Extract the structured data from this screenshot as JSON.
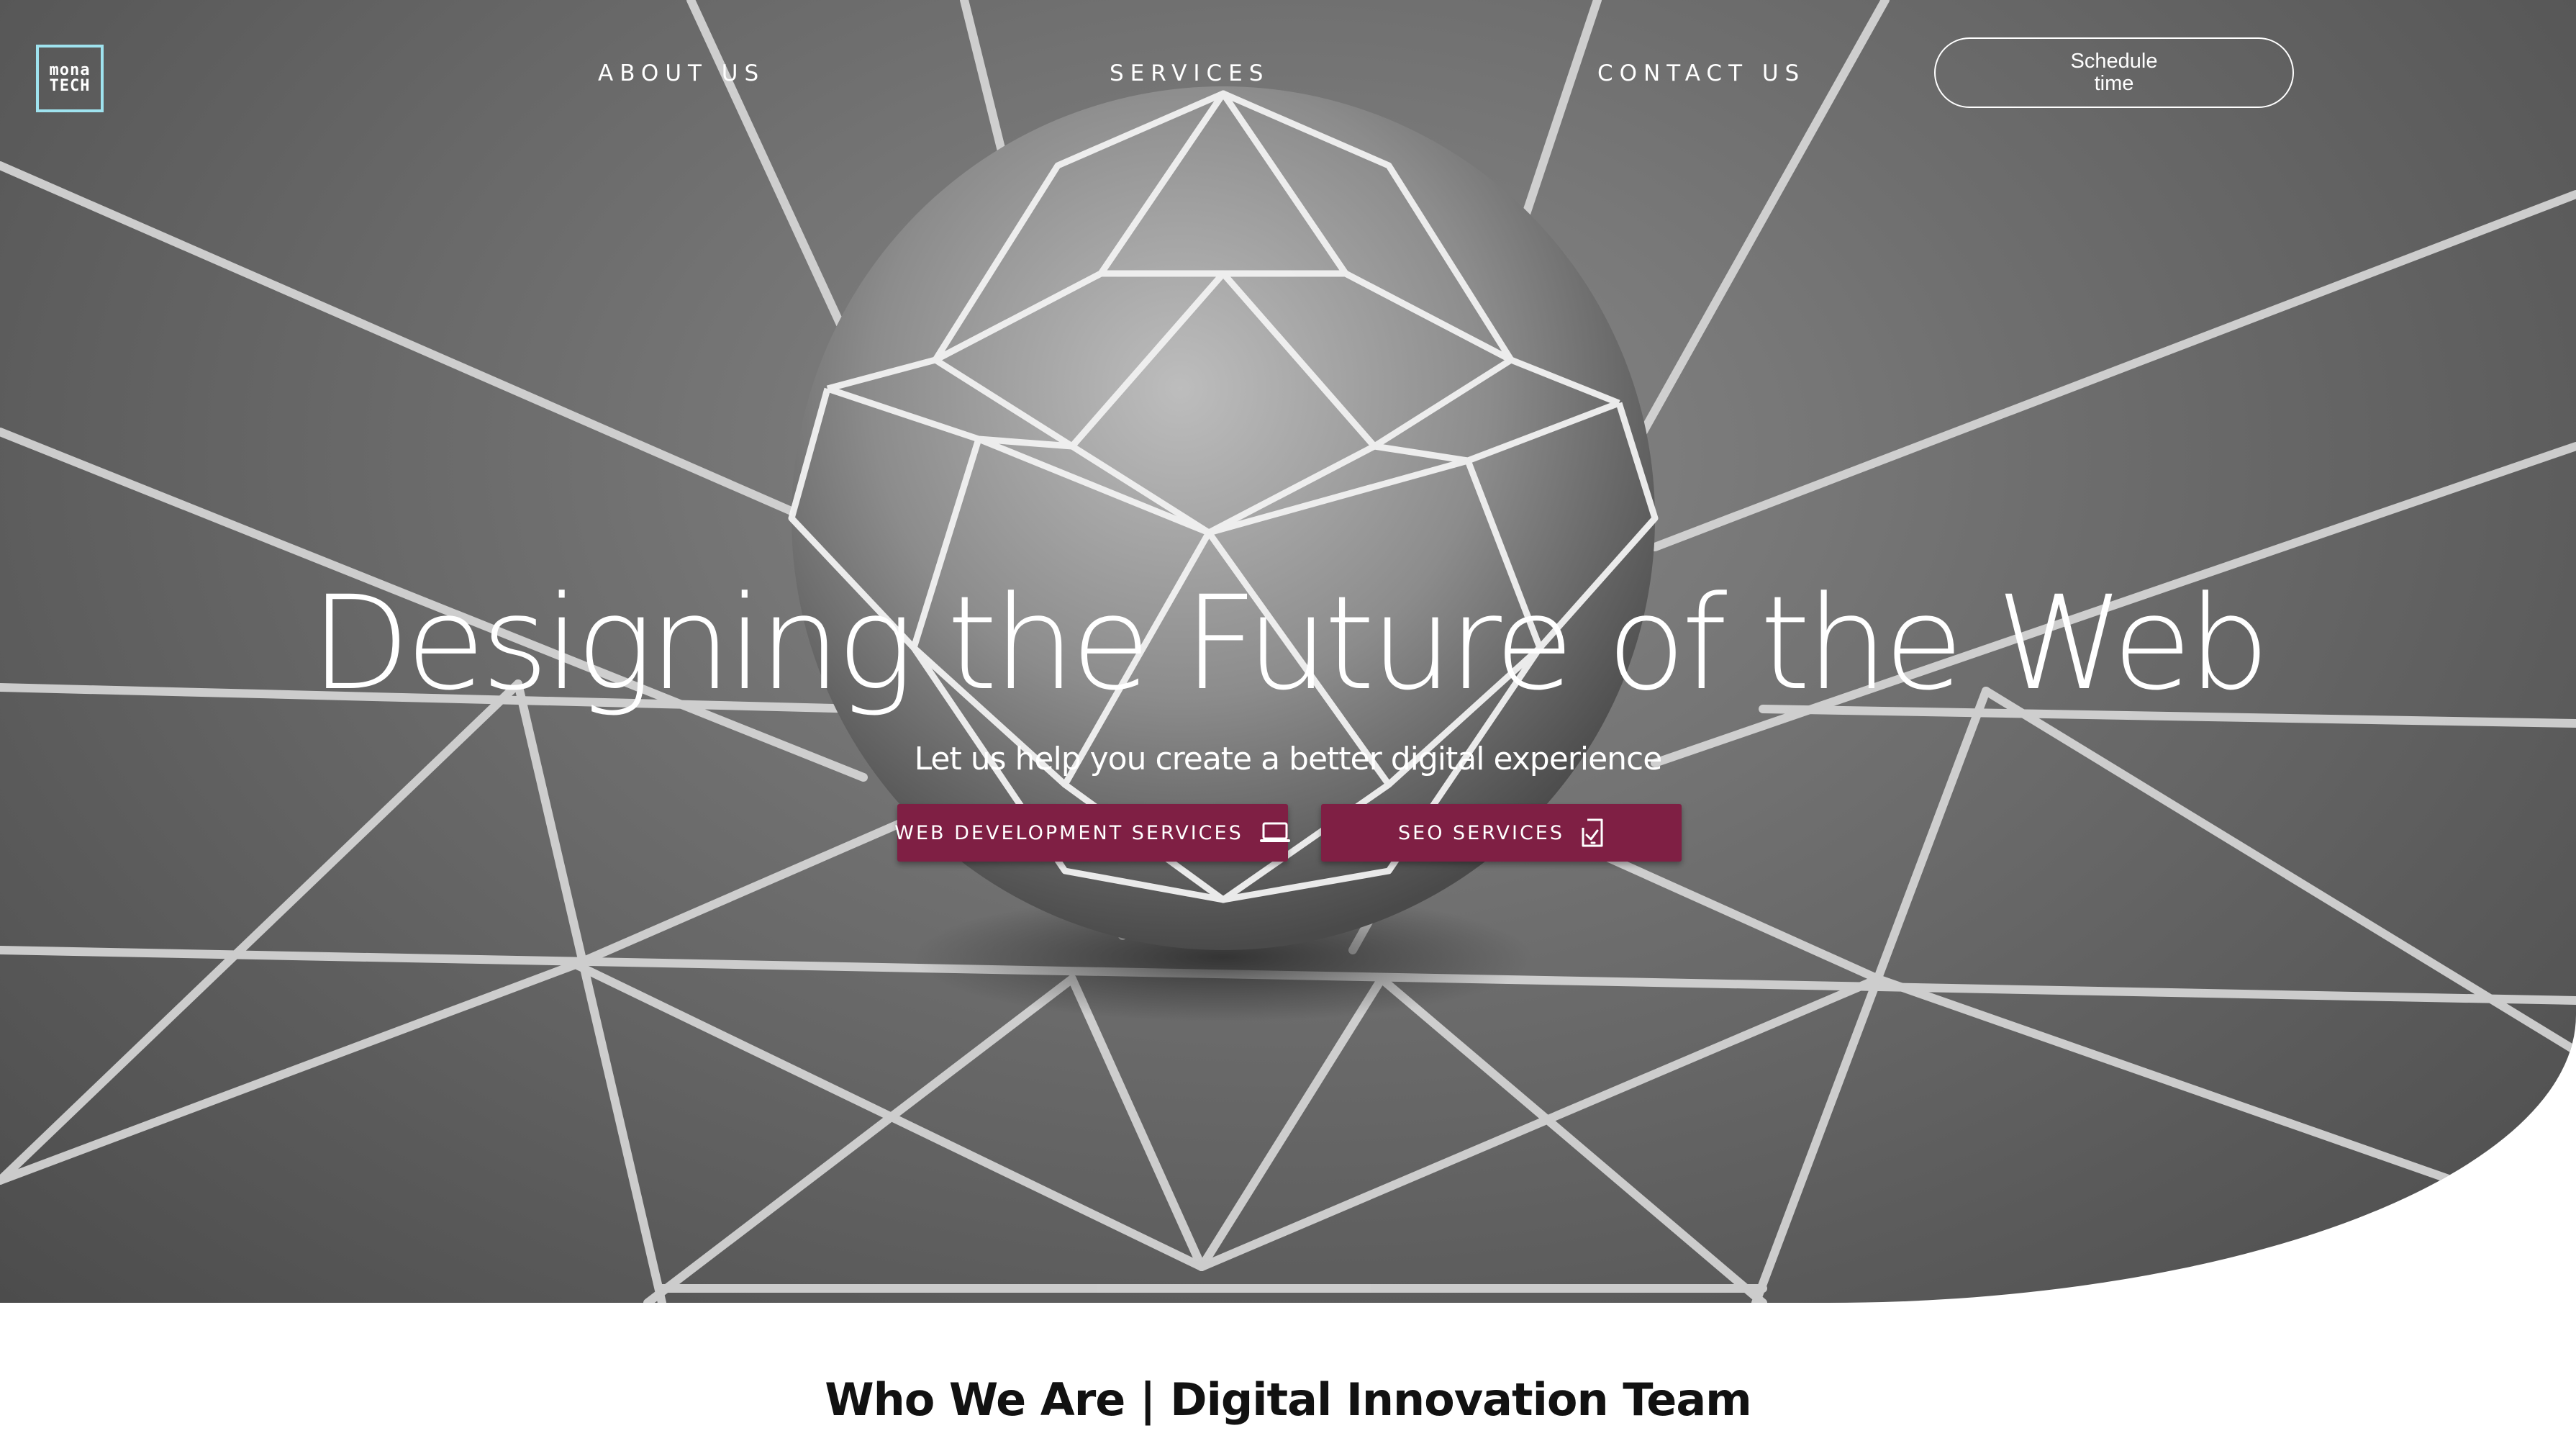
{
  "header": {
    "logo_line1": "mona",
    "logo_line2": "TECH",
    "nav": {
      "about": "ABOUT US",
      "services": "SERVICES",
      "contact": "CONTACT US"
    },
    "schedule_label": "Schedule time"
  },
  "hero": {
    "title": "Designing the Future of the Web",
    "subtitle": "Let us help you create a better digital experience",
    "buttons": {
      "web_dev": "WEB DEVELOPMENT SERVICES",
      "seo": "SEO SERVICES"
    }
  },
  "section": {
    "title": "Who We Are | Digital Innovation Team"
  },
  "colors": {
    "accent": "#7f1f44",
    "logo_border": "#9fe3ef",
    "hero_gray": "#6f6f6f"
  },
  "icons": {
    "web_dev_button": "laptop-icon",
    "seo_button": "tablet-check-icon"
  }
}
